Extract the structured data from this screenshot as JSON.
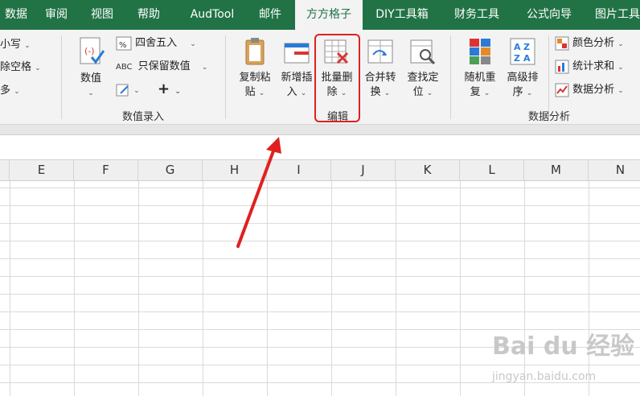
{
  "tabs": [
    {
      "label": "数据"
    },
    {
      "label": "审阅"
    },
    {
      "label": "视图"
    },
    {
      "label": "帮助"
    },
    {
      "label": "AudTool"
    },
    {
      "label": "邮件"
    },
    {
      "label": "方方格子",
      "active": true
    },
    {
      "label": "DIY工具箱"
    },
    {
      "label": "财务工具"
    },
    {
      "label": "公式向导"
    },
    {
      "label": "图片工具"
    }
  ],
  "text_group": {
    "items": [
      "小写",
      "除空格",
      "多"
    ]
  },
  "value_entry": {
    "big_button_label": "数值",
    "round_label": "四舍五入",
    "keep_value_label": "只保留数值",
    "plus_label": "+",
    "group_label": "数值录入"
  },
  "edit_group": {
    "copy_paste_line1": "复制粘",
    "copy_paste_line2": "贴",
    "new_insert_line1": "新增插",
    "new_insert_line2": "入",
    "batch_delete_line1": "批量删",
    "batch_delete_line2": "除",
    "merge_convert_line1": "合并转",
    "merge_convert_line2": "换",
    "find_locate_line1": "查找定",
    "find_locate_line2": "位",
    "group_label": "编辑"
  },
  "data_analysis": {
    "random_line1": "随机重",
    "random_line2": "复",
    "sort_line1": "高级排",
    "sort_line2": "序",
    "color_analysis": "颜色分析",
    "stat_sum": "统计求和",
    "data_analysis": "数据分析",
    "group_label": "数据分析"
  },
  "columns": [
    "E",
    "F",
    "G",
    "H",
    "I",
    "J",
    "K",
    "L",
    "M",
    "N"
  ],
  "watermark": {
    "main": "Bai du 经验",
    "sub": "jingyan.baidu.com"
  },
  "colors": {
    "ribbon_green": "#217346",
    "highlight_red": "#e02020"
  }
}
